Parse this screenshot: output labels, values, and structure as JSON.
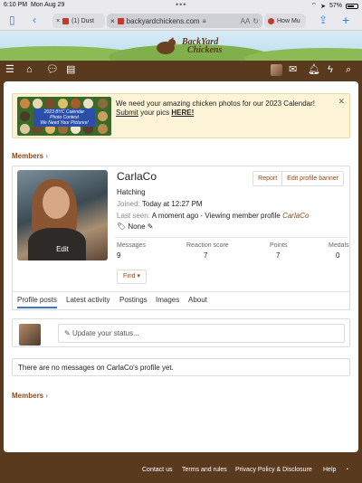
{
  "status_bar": {
    "time": "6:10 PM",
    "date": "Mon Aug 29",
    "battery": "57%"
  },
  "browser": {
    "tabs": [
      {
        "label": "(1) Dust"
      },
      {
        "label": "backyardchickens.com"
      },
      {
        "label": "How Mu"
      }
    ],
    "aa_label": "AA"
  },
  "site": {
    "logo_line1": "BackYard",
    "logo_line2": "Chickens"
  },
  "notice": {
    "text_prefix": "We need your amazing chicken photos for our 2023 Calendar! ",
    "link_submit": "Submit",
    "text_mid": " your pics ",
    "link_here": "HERE!",
    "promo_line1": "2023 BYC Calendar",
    "promo_line2": "Photo Contest",
    "promo_line3": "We Need Your Pictures!"
  },
  "breadcrumb": {
    "label": "Members",
    "sep": "›"
  },
  "profile": {
    "edit_label": "Edit",
    "username": "CarlaCo",
    "user_title": "Hatching",
    "joined_label": "Joined:",
    "joined_value": "Today at 12:27 PM",
    "last_seen_label": "Last seen:",
    "last_seen_value": "A moment ago · Viewing member profile",
    "last_seen_target": "CarlaCo",
    "tags_value": "None",
    "report_label": "Report",
    "edit_banner_label": "Edit profile banner",
    "stats": [
      {
        "label": "Messages",
        "value": "9"
      },
      {
        "label": "Reaction score",
        "value": "7"
      },
      {
        "label": "Points",
        "value": "7"
      },
      {
        "label": "Medals",
        "value": "0"
      }
    ],
    "find_label": "Find ▾",
    "tabs": [
      "Profile posts",
      "Latest activity",
      "Postings",
      "Images",
      "About"
    ]
  },
  "status_input": {
    "placeholder": "Update your status..."
  },
  "empty_message": "There are no messages on CarlaCo's profile yet.",
  "footer": {
    "links": [
      "Contact us",
      "Terms and rules",
      "Privacy Policy & Disclosure",
      "Help"
    ]
  },
  "colors": {
    "brand_brown": "#5a3a1e",
    "accent_link": "#8a4a1a",
    "active_tab": "#3a77c4",
    "notice_bg": "#fdf4d8"
  },
  "icons": [
    "sidebar-icon",
    "back-icon",
    "share-icon",
    "new-tab-icon",
    "tabs-icon",
    "menu-icon",
    "home-icon",
    "chat-icon",
    "document-icon",
    "mail-icon",
    "alerts-icon",
    "bolt-icon",
    "search-icon",
    "tag-icon",
    "pencil-icon",
    "rss-icon",
    "close-icon",
    "reload-icon",
    "lock-icon"
  ]
}
